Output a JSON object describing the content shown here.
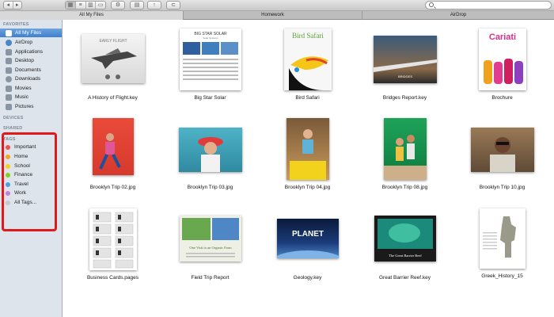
{
  "toolbar": {
    "back_icon": "back-arrow-icon",
    "forward_icon": "forward-arrow-icon",
    "view_icons": [
      "icon-view-icon",
      "list-view-icon",
      "column-view-icon",
      "coverflow-view-icon"
    ],
    "action_icon": "gear-icon",
    "arrange_icon": "arrange-icon",
    "share_icon": "share-icon",
    "tag_icon": "tag-icon",
    "search_placeholder": ""
  },
  "tabs": [
    {
      "label": "All My Files",
      "active": true
    },
    {
      "label": "Homework",
      "active": false
    },
    {
      "label": "AirDrop",
      "active": false
    }
  ],
  "sidebar": {
    "favorites_header": "FAVORITES",
    "favorites": [
      {
        "label": "All My Files",
        "icon": "all-files-icon",
        "selected": true
      },
      {
        "label": "AirDrop",
        "icon": "airdrop-icon",
        "selected": false
      },
      {
        "label": "Applications",
        "icon": "applications-icon",
        "selected": false
      },
      {
        "label": "Desktop",
        "icon": "desktop-icon",
        "selected": false
      },
      {
        "label": "Documents",
        "icon": "documents-icon",
        "selected": false
      },
      {
        "label": "Downloads",
        "icon": "downloads-icon",
        "selected": false
      },
      {
        "label": "Movies",
        "icon": "movies-icon",
        "selected": false
      },
      {
        "label": "Music",
        "icon": "music-icon",
        "selected": false
      },
      {
        "label": "Pictures",
        "icon": "pictures-icon",
        "selected": false
      }
    ],
    "devices_header": "DEVICES",
    "shared_header": "SHARED",
    "tags_header": "TAGS",
    "tags": [
      {
        "label": "Important",
        "color": "#f0504f"
      },
      {
        "label": "Home",
        "color": "#f5a623"
      },
      {
        "label": "School",
        "color": "#f3d21b"
      },
      {
        "label": "Finance",
        "color": "#7ed321"
      },
      {
        "label": "Travel",
        "color": "#4aa3e0"
      },
      {
        "label": "Work",
        "color": "#c77ddb"
      },
      {
        "label": "All Tags...",
        "color": "#c8c8c8"
      }
    ],
    "tags_highlight_color": "#e01a1a"
  },
  "files": [
    {
      "name": "A History of Flight.key"
    },
    {
      "name": "Big Star Solar"
    },
    {
      "name": "Bird Safari"
    },
    {
      "name": "Bridges Report.key"
    },
    {
      "name": "Brochure"
    },
    {
      "name": "Brooklyn Trip 02.jpg"
    },
    {
      "name": "Brooklyn Trip 03.jpg"
    },
    {
      "name": "Brooklyn Trip 04.jpg"
    },
    {
      "name": "Brooklyn Trip 08.jpg"
    },
    {
      "name": "Brooklyn Trip 10.jpg"
    },
    {
      "name": "Business Cards.pages"
    },
    {
      "name": "Field Trip Report"
    },
    {
      "name": "Geology.key"
    },
    {
      "name": "Great Barrier Reef.key"
    },
    {
      "name": "Greek_History_15"
    }
  ],
  "thumb_text": {
    "flight": "EARLY FLIGHT",
    "solar_title": "BIG STAR SOLAR",
    "solar_sub": "Solar Systems",
    "bird": "Bird Safari",
    "bridges": "BRIDGES",
    "brochure": "Cariati",
    "farm": "One Visit to an Organic Farm",
    "planet": "PLANET",
    "reef": "The Great Barrier Reef"
  }
}
